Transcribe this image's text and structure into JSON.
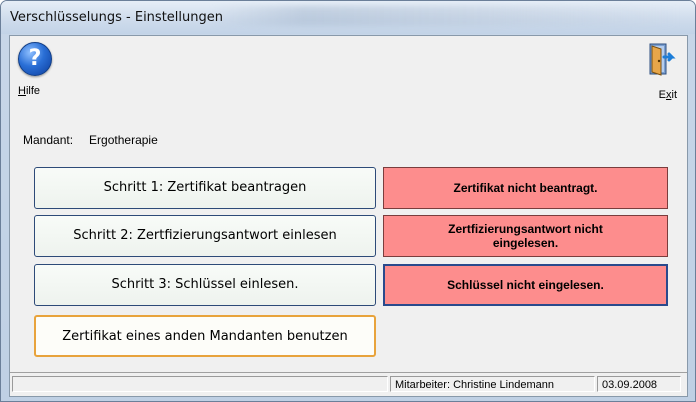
{
  "window": {
    "title": "Verschlüsselungs - Einstellungen"
  },
  "toolbar": {
    "help_label": "Hilfe",
    "help_mnemonic": "H",
    "exit_label": "Exit",
    "help_icon": "help-icon",
    "exit_icon": "exit-door-icon"
  },
  "mandant": {
    "label": "Mandant:",
    "value": "Ergotherapie"
  },
  "steps": [
    {
      "button": "Schritt 1: Zertifikat beantragen",
      "status": "Zertifikat nicht beantragt."
    },
    {
      "button": "Schritt 2: Zertfizierungsantwort einlesen",
      "status": "Zertfizierungsantwort nicht eingelesen."
    },
    {
      "button": "Schritt 3: Schlüssel einlesen.",
      "status": "Schlüssel nicht eingelesen."
    }
  ],
  "other_mandant_button": "Zertifikat eines anden Mandanten benutzen",
  "statusbar": {
    "panel1": "",
    "employee": "Mitarbeiter:  Christine Lindemann",
    "date": "03.09.2008"
  },
  "colors": {
    "status_error": "#fd8d8d",
    "button_focus_border": "#e8a33c"
  }
}
